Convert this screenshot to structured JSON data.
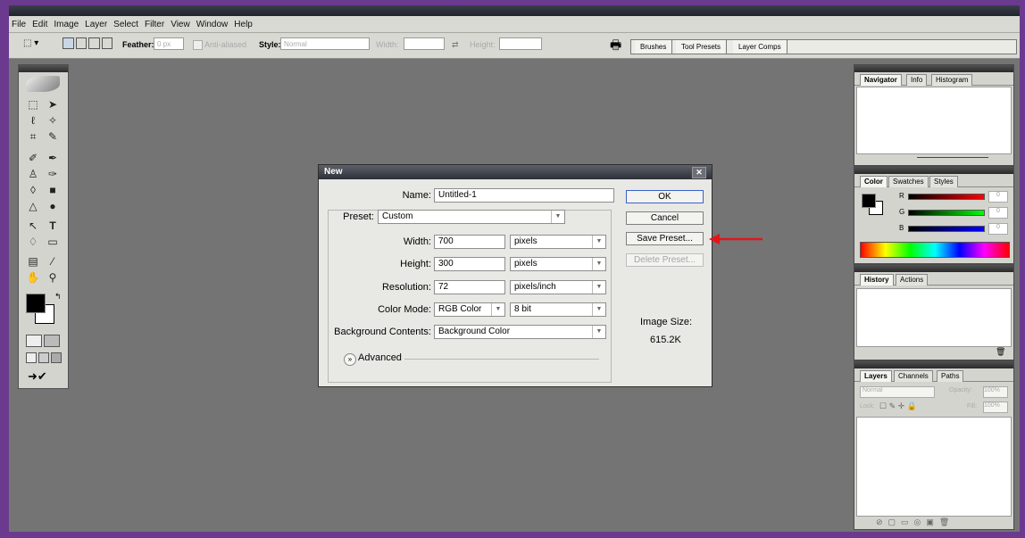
{
  "menu": [
    "File",
    "Edit",
    "Image",
    "Layer",
    "Select",
    "Filter",
    "View",
    "Window",
    "Help"
  ],
  "options": {
    "feather_label": "Feather:",
    "feather_value": "0 px",
    "anti_aliased": "Anti-aliased",
    "style_label": "Style:",
    "style_value": "Normal",
    "width_label": "Width:",
    "height_label": "Height:"
  },
  "well_tabs": [
    "Brushes",
    "Tool Presets",
    "Layer Comps"
  ],
  "dialog": {
    "title": "New",
    "name_label": "Name:",
    "name_value": "Untitled-1",
    "preset_label": "Preset:",
    "preset_value": "Custom",
    "width_label": "Width:",
    "width_value": "700",
    "width_unit": "pixels",
    "height_label": "Height:",
    "height_value": "300",
    "height_unit": "pixels",
    "resolution_label": "Resolution:",
    "resolution_value": "72",
    "resolution_unit": "pixels/inch",
    "color_mode_label": "Color Mode:",
    "color_mode_value": "RGB Color",
    "bit_depth": "8 bit",
    "bg_label": "Background Contents:",
    "bg_value": "Background Color",
    "advanced": "Advanced",
    "ok": "OK",
    "cancel": "Cancel",
    "save_preset": "Save Preset...",
    "delete_preset": "Delete Preset...",
    "image_size_label": "Image Size:",
    "image_size_value": "615.2K"
  },
  "navigator_tabs": [
    "Navigator",
    "Info",
    "Histogram"
  ],
  "color_tabs": [
    "Color",
    "Swatches",
    "Styles"
  ],
  "color_channels": [
    {
      "label": "R",
      "value": "0"
    },
    {
      "label": "G",
      "value": "0"
    },
    {
      "label": "B",
      "value": "0"
    }
  ],
  "history_tabs": [
    "History",
    "Actions"
  ],
  "layers_tabs": [
    "Layers",
    "Channels",
    "Paths"
  ],
  "layers": {
    "blend": "Normal",
    "opacity_label": "Opacity:",
    "opacity_value": "100%",
    "lock_label": "Lock:",
    "fill_label": "Fill:",
    "fill_value": "100%"
  },
  "colors": {
    "accent_arrow": "#e0161b",
    "default_btn": "#3b62c8",
    "canvas": "#747474"
  }
}
